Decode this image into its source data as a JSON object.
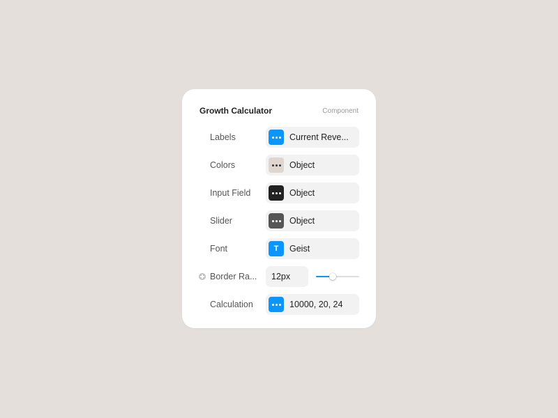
{
  "panel": {
    "title": "Growth Calculator",
    "kind": "Component"
  },
  "rows": {
    "labels": {
      "label": "Labels",
      "value": "Current Reve...",
      "swatch_color": "#0a95ff",
      "dot_color": "#ffffff",
      "icon": "dots-icon"
    },
    "colors": {
      "label": "Colors",
      "value": "Object",
      "swatch_color": "#dfd7cf",
      "dot_color": "#333333",
      "icon": "dots-icon"
    },
    "input_field": {
      "label": "Input Field",
      "value": "Object",
      "swatch_color": "#222222",
      "dot_color": "#ffffff",
      "icon": "dots-icon"
    },
    "slider": {
      "label": "Slider",
      "value": "Object",
      "swatch_color": "#555555",
      "dot_color": "#ffffff",
      "icon": "dots-icon"
    },
    "font": {
      "label": "Font",
      "value": "Geist",
      "swatch_color": "#0a95ff",
      "glyph": "T",
      "icon": "font-icon"
    },
    "border_radius": {
      "label": "Border Ra...",
      "value": "12px",
      "slider_fraction": 0.38,
      "accent": "#0a95ff",
      "icon": "add-icon"
    },
    "calculation": {
      "label": "Calculation",
      "value": "10000, 20, 24",
      "swatch_color": "#0a95ff",
      "dot_color": "#ffffff",
      "icon": "dots-icon"
    }
  }
}
